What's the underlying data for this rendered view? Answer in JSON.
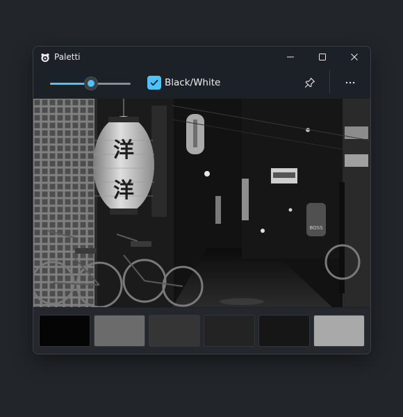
{
  "window": {
    "title": "Paletti",
    "icon": "paletti-app-icon",
    "controls": [
      "minimize-icon",
      "maximize-icon",
      "close-icon"
    ]
  },
  "toolbar": {
    "slider": {
      "value_fraction": 0.51,
      "accent": "#4cc2ff"
    },
    "checkbox": {
      "label": "Black/White",
      "checked": true
    },
    "pin_icon": "pin-icon",
    "more_icon": "more-horizontal-icon"
  },
  "image": {
    "description_icon": "photo-night-alley-grayscale",
    "lantern_characters": [
      "洋",
      "洋"
    ],
    "sign_text": [
      "BOSS"
    ]
  },
  "palette": {
    "swatches": [
      {
        "color": "#050505"
      },
      {
        "color": "#6b6b6b"
      },
      {
        "color": "#353535"
      },
      {
        "color": "#232323"
      },
      {
        "color": "#161616"
      },
      {
        "color": "#a9a9a9"
      }
    ]
  }
}
